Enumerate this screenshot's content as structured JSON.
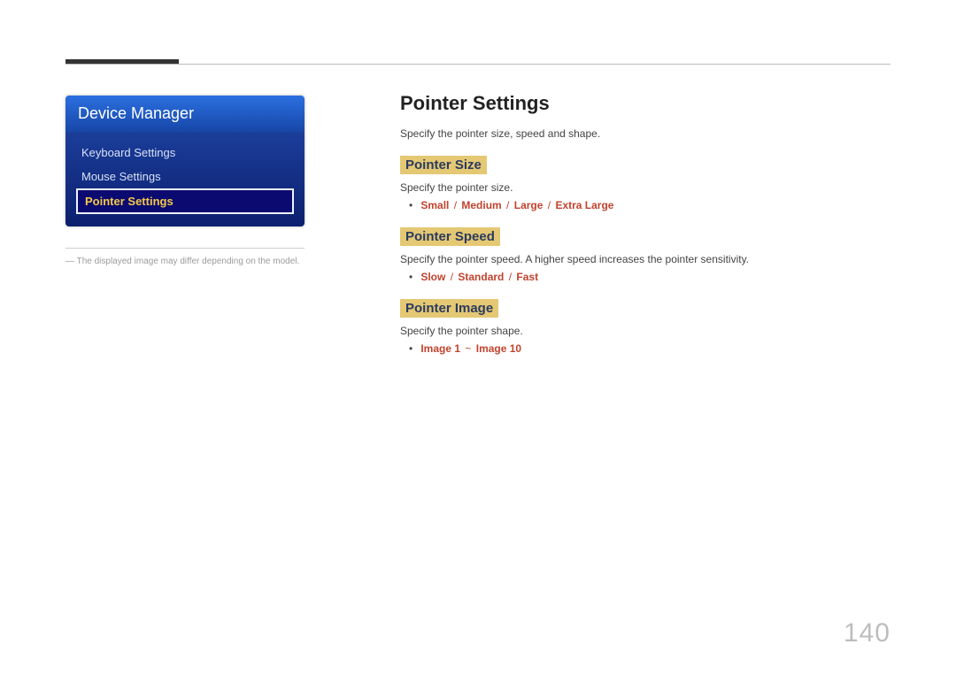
{
  "sidebar": {
    "title": "Device Manager",
    "items": [
      {
        "label": "Keyboard Settings",
        "active": false
      },
      {
        "label": "Mouse Settings",
        "active": false
      },
      {
        "label": "Pointer Settings",
        "active": true
      }
    ],
    "footnote_prefix": "―",
    "footnote": "The displayed image may differ depending on the model."
  },
  "main": {
    "title": "Pointer Settings",
    "intro": "Specify the pointer size, speed and shape.",
    "sections": [
      {
        "heading": "Pointer Size",
        "desc": "Specify the pointer size.",
        "options": [
          "Small",
          "Medium",
          "Large",
          "Extra Large"
        ],
        "separator": " / "
      },
      {
        "heading": "Pointer Speed",
        "desc": "Specify the pointer speed. A higher speed increases the pointer sensitivity.",
        "options": [
          "Slow",
          "Standard",
          "Fast"
        ],
        "separator": " / "
      },
      {
        "heading": "Pointer Image",
        "desc": "Specify the pointer shape.",
        "options": [
          "Image 1",
          "Image 10"
        ],
        "separator": " ~ "
      }
    ]
  },
  "page_number": "140"
}
